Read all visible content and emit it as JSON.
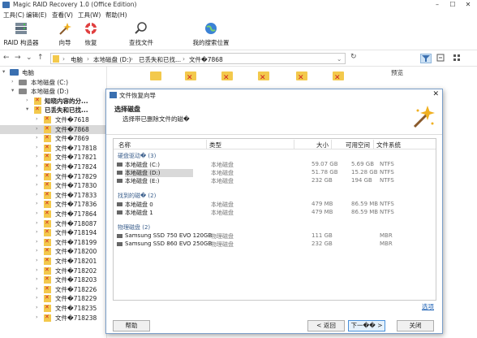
{
  "window": {
    "title": "Magic RAID Recovery 1.0 (Office Edition)",
    "minimize": "–",
    "maximize": "☐",
    "close": "✕"
  },
  "menu": [
    "工具(C)",
    "编辑(E)",
    "查看(V)",
    "工具(W)",
    "帮助(H)"
  ],
  "toolbar": {
    "raid_builder": "RAID 构造器",
    "wizard": "向导",
    "recover": "恢复",
    "find_file": "查找文件",
    "my_favorites": "我的搜索位置"
  },
  "address": {
    "nav_back": "←",
    "nav_forward": "→",
    "nav_dropdown": "⌄",
    "nav_up": "↑",
    "crumbs": [
      "电脑",
      "本地磁盘 (D:)",
      "已丢失和已找...",
      "文件�7868"
    ],
    "sep": "›"
  },
  "preview_label": "预览",
  "tree": {
    "root": "电脑",
    "drive_c": "本地磁盘 (C:)",
    "drive_d": "本地磁盘 (D:)",
    "unknown": "知晓内容的分...",
    "lost": "已丢失和已找...",
    "items": [
      "文件�7618",
      "文件�7868",
      "文件�7869",
      "文件�717818",
      "文件�717821",
      "文件�717824",
      "文件�717829",
      "文件�717830",
      "文件�717833",
      "文件�717836",
      "文件�717864",
      "文件�718087",
      "文件�718194",
      "文件�718199",
      "文件�718200",
      "文件�718201",
      "文件�718202",
      "文件�718203",
      "文件�718226",
      "文件�718229",
      "文件�718235",
      "文件�718238"
    ]
  },
  "dialog": {
    "title": "文件恢复向导",
    "heading": "选择磁盘",
    "subheading": "选择带已删除文件的磁�",
    "columns": {
      "name": "名称",
      "type": "类型",
      "size": "大小",
      "free": "可用空间",
      "fs": "文件系统"
    },
    "groups": [
      {
        "label": "硬盘驱动� (3)",
        "rows": [
          {
            "name": "本地磁盘 (C:)",
            "type": "本地磁盘",
            "size": "59.07 GB",
            "free": "5.69 GB",
            "fs": "NTFS",
            "selected": false
          },
          {
            "name": "本地磁盘 (D:)",
            "type": "本地磁盘",
            "size": "51.78 GB",
            "free": "15.28 GB",
            "fs": "NTFS",
            "selected": true
          },
          {
            "name": "本地磁盘 (E:)",
            "type": "本地磁盘",
            "size": "232 GB",
            "free": "194 GB",
            "fs": "NTFS",
            "selected": false
          }
        ]
      },
      {
        "label": "找到的磁� (2)",
        "rows": [
          {
            "name": "本地磁盘 0",
            "type": "本地磁盘",
            "size": "479 MB",
            "free": "86.59 MB",
            "fs": "NTFS",
            "selected": false
          },
          {
            "name": "本地磁盘 1",
            "type": "本地磁盘",
            "size": "479 MB",
            "free": "86.59 MB",
            "fs": "NTFS",
            "selected": false
          }
        ]
      },
      {
        "label": "物理磁盘 (2)",
        "rows": [
          {
            "name": "Samsung SSD 750 EVO 120GB",
            "type": "物理磁盘",
            "size": "111 GB",
            "free": "",
            "fs": "MBR",
            "selected": false
          },
          {
            "name": "Samsung SSD 860 EVO 250GB",
            "type": "物理磁盘",
            "size": "232 GB",
            "free": "",
            "fs": "MBR",
            "selected": false
          }
        ]
      }
    ],
    "link": "选项",
    "buttons": {
      "help": "帮助",
      "back": "< 返回",
      "next": "下一�� >",
      "close": "关闭"
    }
  },
  "colors": {
    "accent": "#3a6fb0",
    "folder": "#f3c94c",
    "deleted_mark": "#d02020",
    "selection": "#d9d9d9"
  }
}
